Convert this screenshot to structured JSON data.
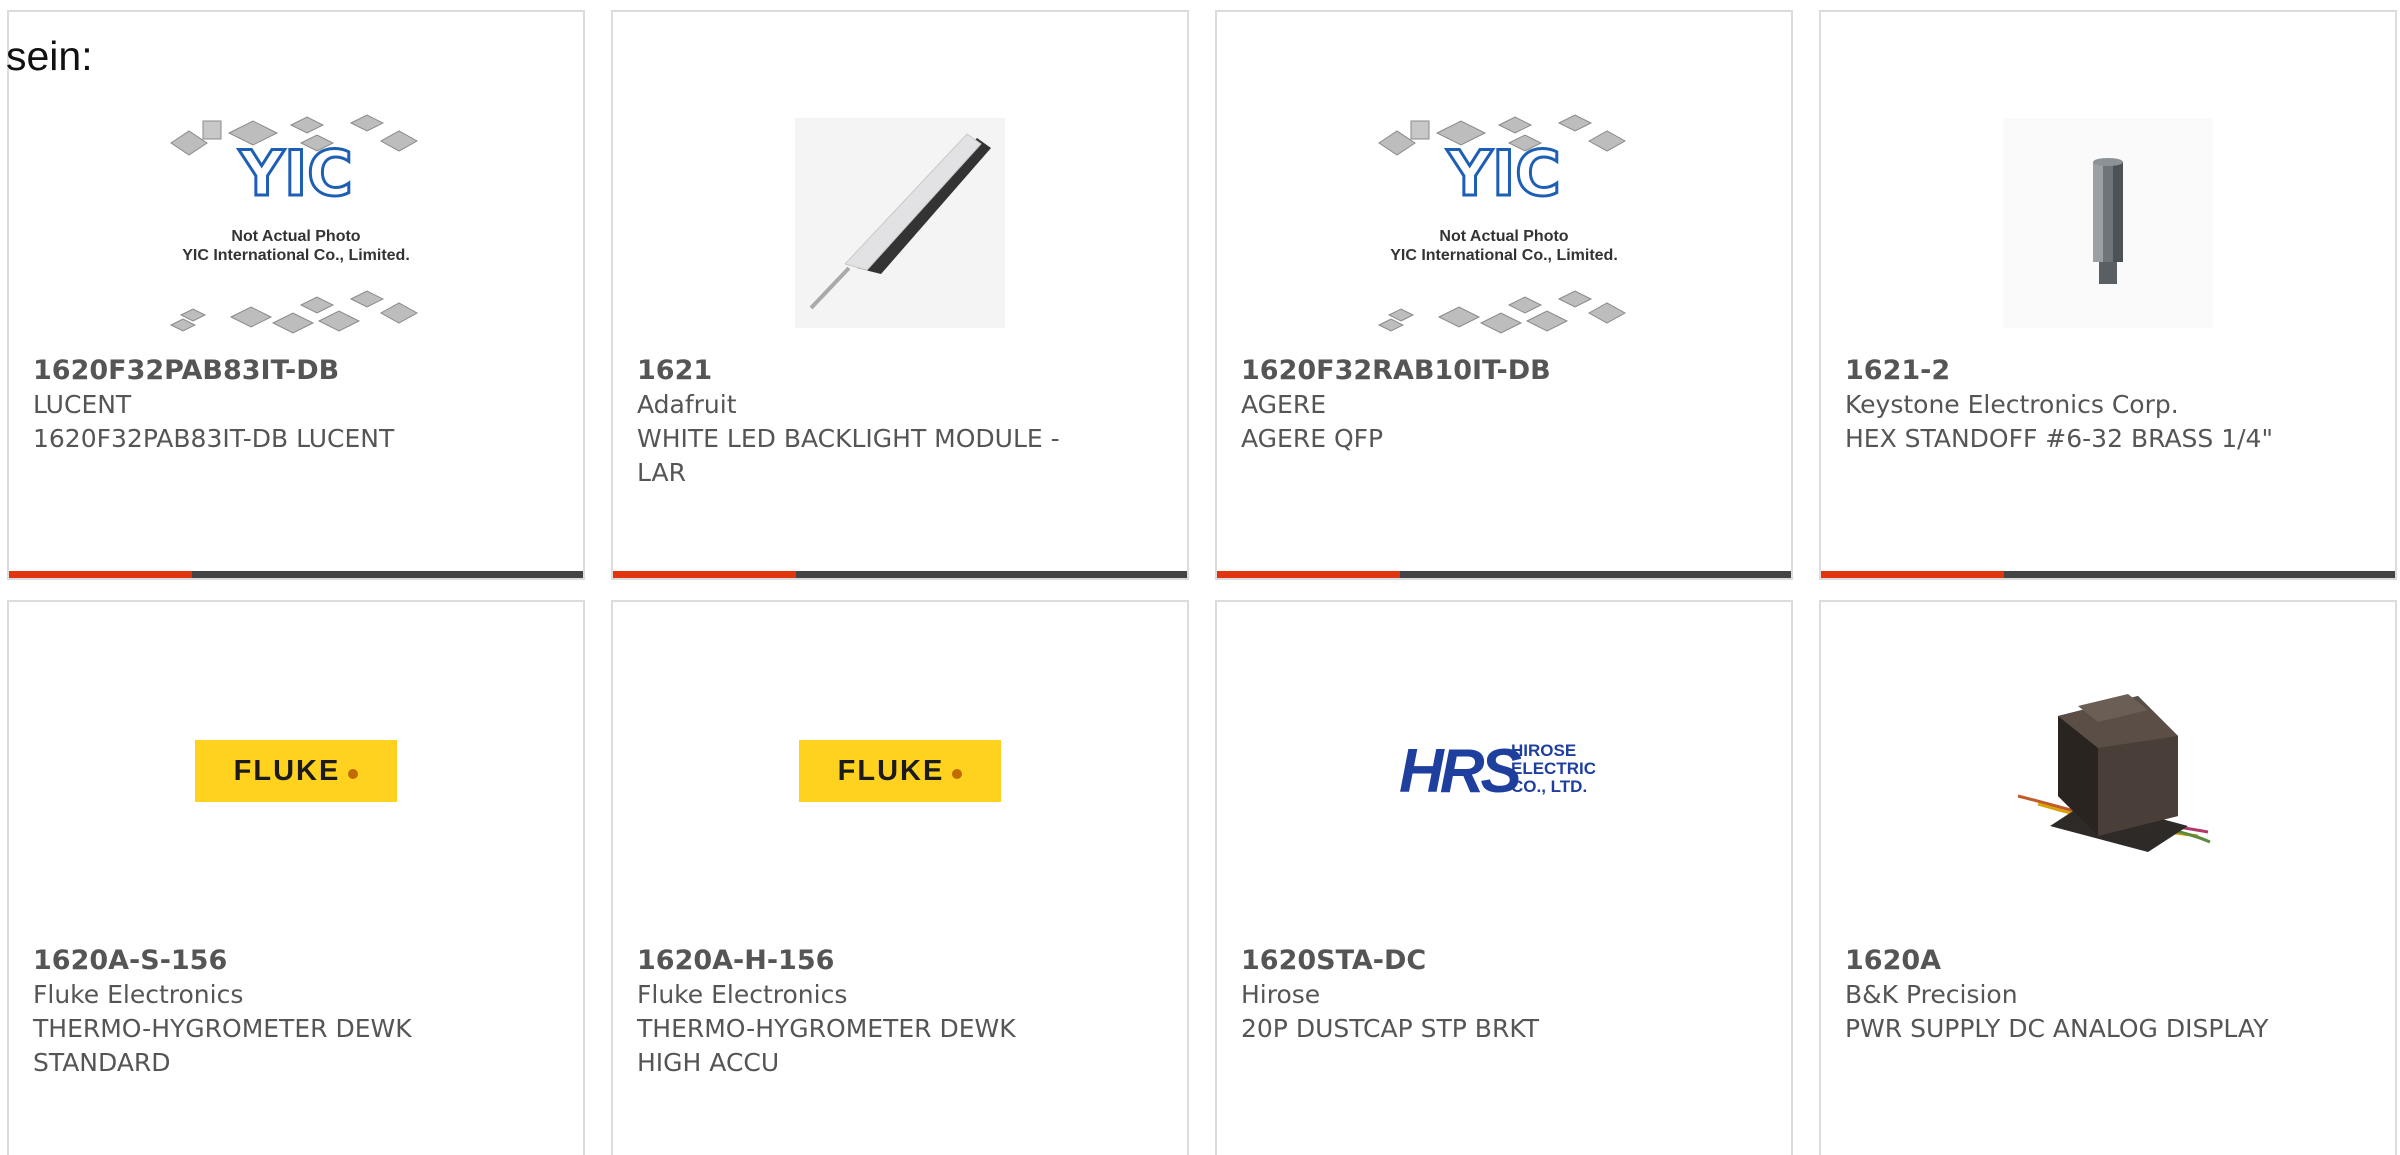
{
  "heading": "sein:",
  "products": [
    {
      "part": "1620F32PAB83IT-DB",
      "maker": "LUCENT",
      "description": "1620F32PAB83IT-DB LUCENT",
      "image": "yic-placeholder",
      "image_text": [
        "Not Actual Photo",
        "YIC International Co., Limited."
      ]
    },
    {
      "part": "1621",
      "maker": "Adafruit",
      "description": "WHITE LED BACKLIGHT MODULE - LAR",
      "image": "led-backlight-strip"
    },
    {
      "part": "1620F32RAB10IT-DB",
      "maker": "AGERE",
      "description": "AGERE QFP",
      "image": "yic-placeholder",
      "image_text": [
        "Not Actual Photo",
        "YIC International Co., Limited."
      ]
    },
    {
      "part": "1621-2",
      "maker": "Keystone Electronics Corp.",
      "description": "HEX STANDOFF #6-32 BRASS 1/4\"",
      "image": "hex-standoff"
    },
    {
      "part": "1620A-S-156",
      "maker": "Fluke Electronics",
      "description": "THERMO-HYGROMETER DEWK STANDARD",
      "image": "fluke-logo",
      "logo_text": "FLUKE"
    },
    {
      "part": "1620A-H-156",
      "maker": "Fluke Electronics",
      "description": "THERMO-HYGROMETER DEWK HIGH ACCU",
      "image": "fluke-logo",
      "logo_text": "FLUKE"
    },
    {
      "part": "1620STA-DC",
      "maker": "Hirose",
      "description": "20P DUSTCAP STP BRKT",
      "image": "hirose-logo",
      "logo_text": [
        "HRS",
        "HIROSE",
        "ELECTRIC",
        "CO., LTD."
      ]
    },
    {
      "part": "1620A",
      "maker": "B&K Precision",
      "description": "PWR SUPPLY DC ANALOG DISPLAY",
      "image": "transformer"
    }
  ],
  "colors": {
    "accent_bar": "#e0350f",
    "dark_bar": "#444444",
    "card_border": "#dcdcdc",
    "text": "#555555",
    "fluke_yellow": "#ffd21f",
    "hirose_blue": "#1f3f9e"
  }
}
